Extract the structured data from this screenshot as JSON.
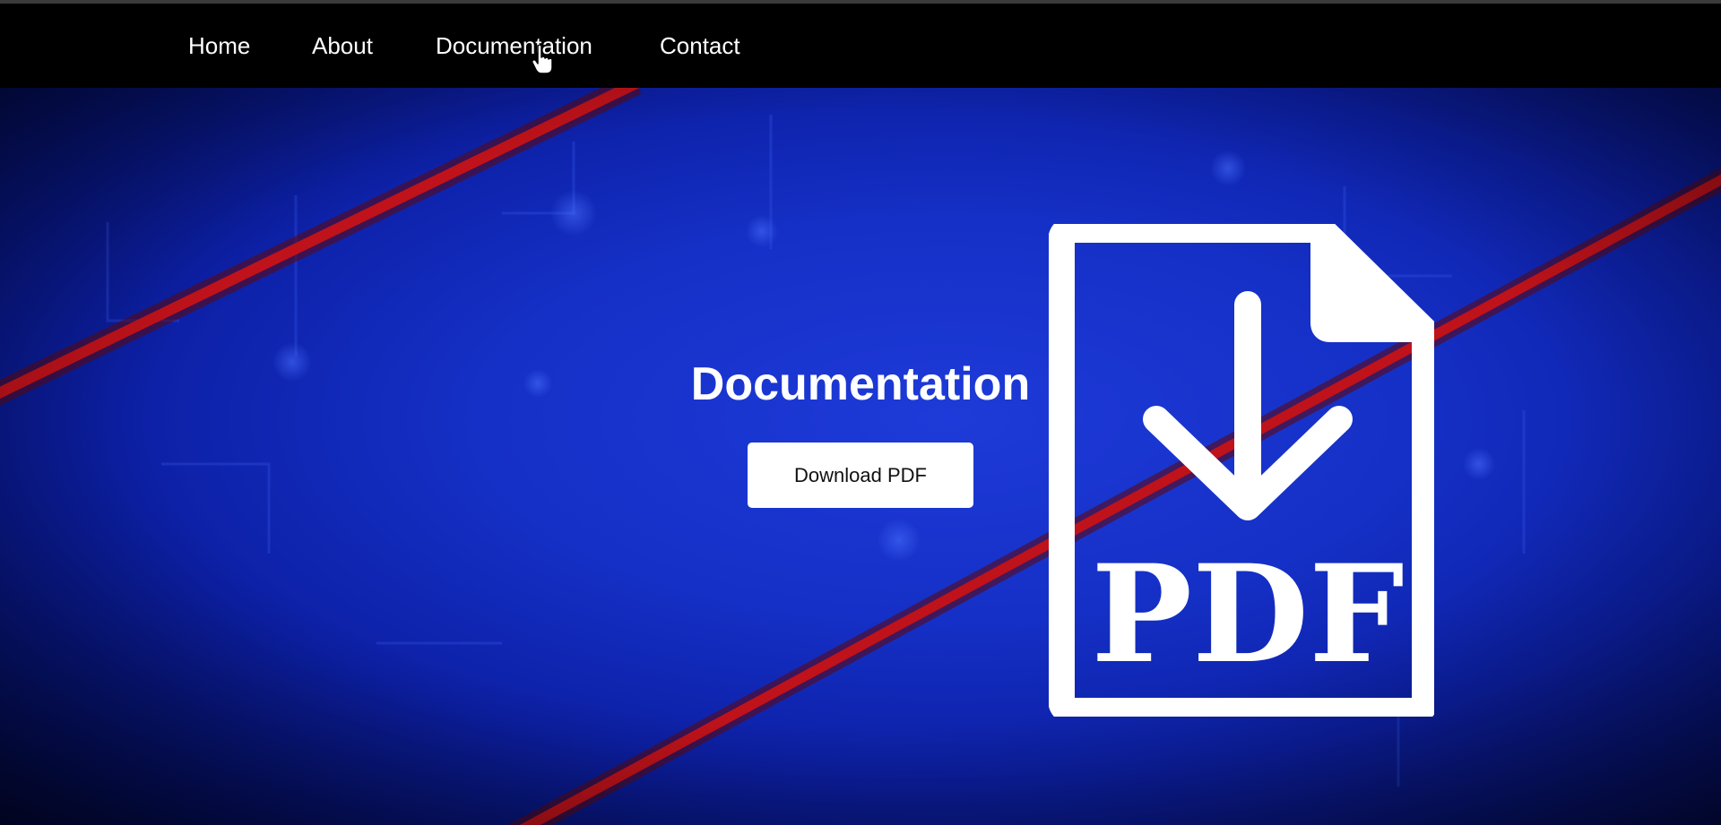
{
  "navbar": {
    "items": [
      {
        "label": "Home"
      },
      {
        "label": "About"
      },
      {
        "label": "Documentation"
      },
      {
        "label": "Contact"
      }
    ]
  },
  "hero": {
    "title": "Documentation",
    "button_label": "Download PDF",
    "graphic": {
      "icon": "pdf-download-icon",
      "label": "PDF"
    }
  },
  "cursor": {
    "icon": "hand-pointer-icon"
  },
  "colors": {
    "navbar_bg": "#000000",
    "hero_blue": "#1530c6",
    "accent_red": "#c0121a",
    "button_bg": "#ffffff",
    "text_light": "#ffffff"
  }
}
